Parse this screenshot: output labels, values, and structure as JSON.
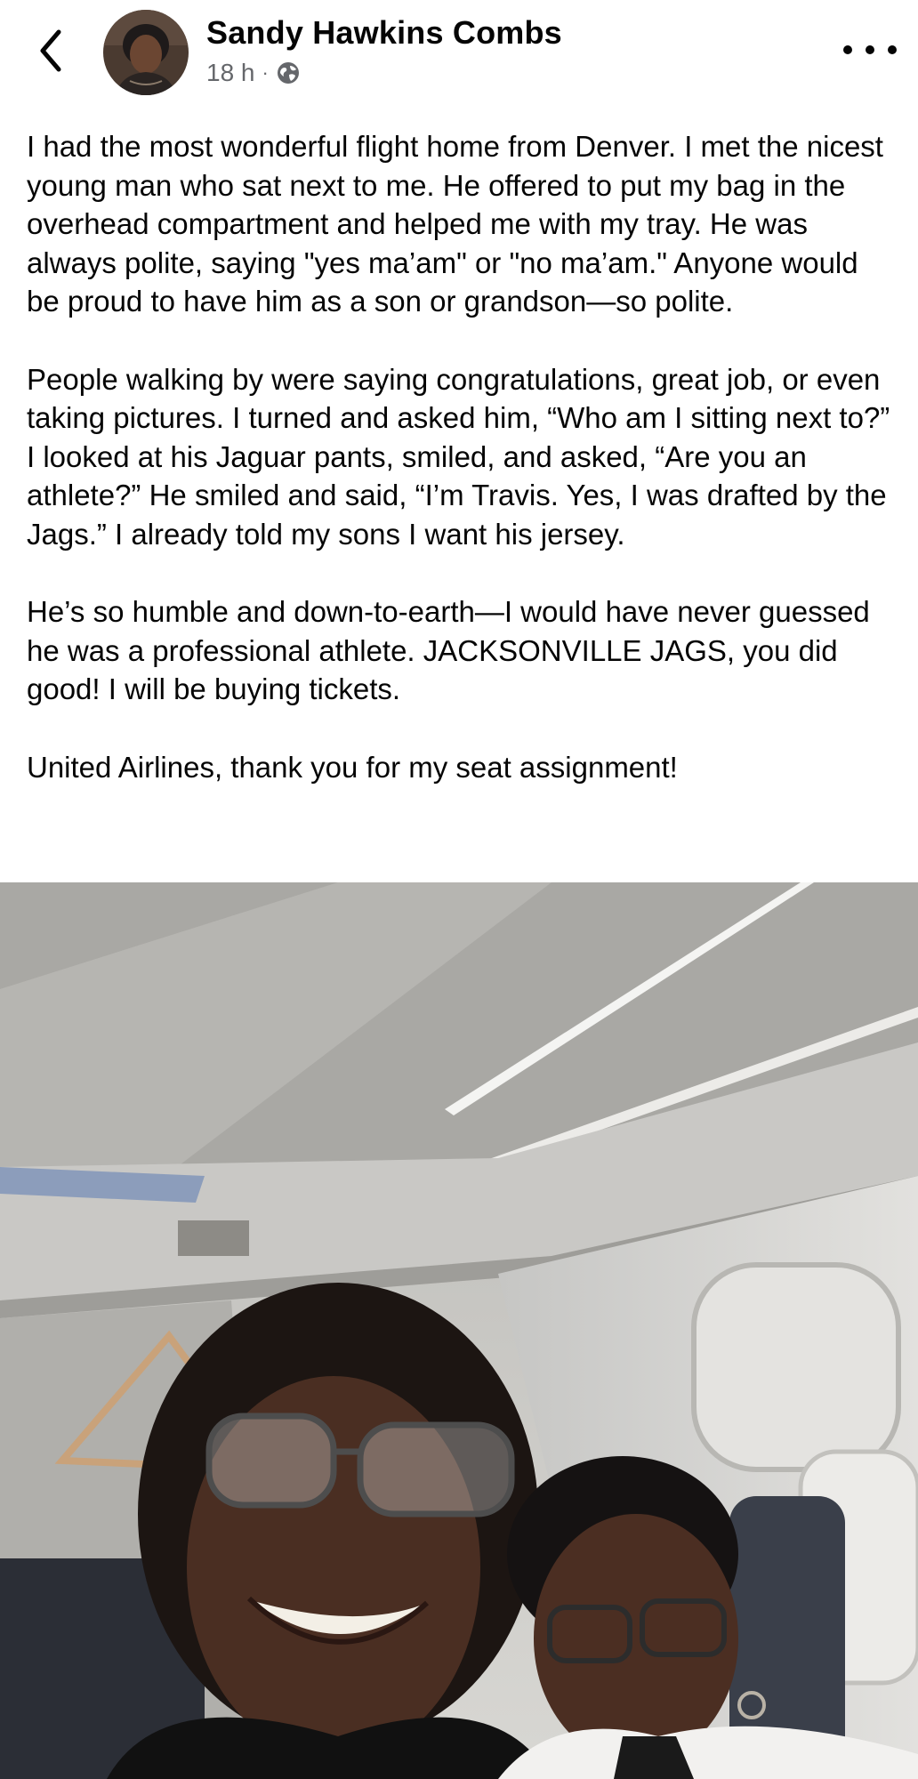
{
  "post": {
    "author": "Sandy Hawkins Combs",
    "time": "18 h",
    "separator": "·",
    "audience_icon": "globe-icon",
    "paragraphs": [
      "I had the most wonderful flight home from Denver. I met the nicest young man who sat next to me. He offered to put my bag in the overhead compartment and helped me with my tray. He was always polite, saying \"yes ma’am\" or \"no ma’am.\" Anyone would be proud to have him as a son or grandson—so polite.",
      "People walking by were saying congratulations, great job, or even taking pictures. I turned and asked him, “Who am I sitting next to?” I looked at his Jaguar pants, smiled, and asked, “Are you an athlete?” He smiled and said, “I’m Travis. Yes, I was drafted by the Jags.” I already told my sons I want his jersey.",
      "He’s so humble and down-to-earth—I would have never guessed he was a professional athlete. JACKSONVILLE JAGS, you did good! I will be buying tickets.",
      "United Airlines, thank you for my seat assignment!"
    ]
  },
  "icons": {
    "back": "chevron-left-icon",
    "more": "more-horizontal-icon",
    "avatar": "avatar"
  },
  "colors": {
    "text": "#050505",
    "secondary_text": "#65676b",
    "background": "#ffffff"
  }
}
